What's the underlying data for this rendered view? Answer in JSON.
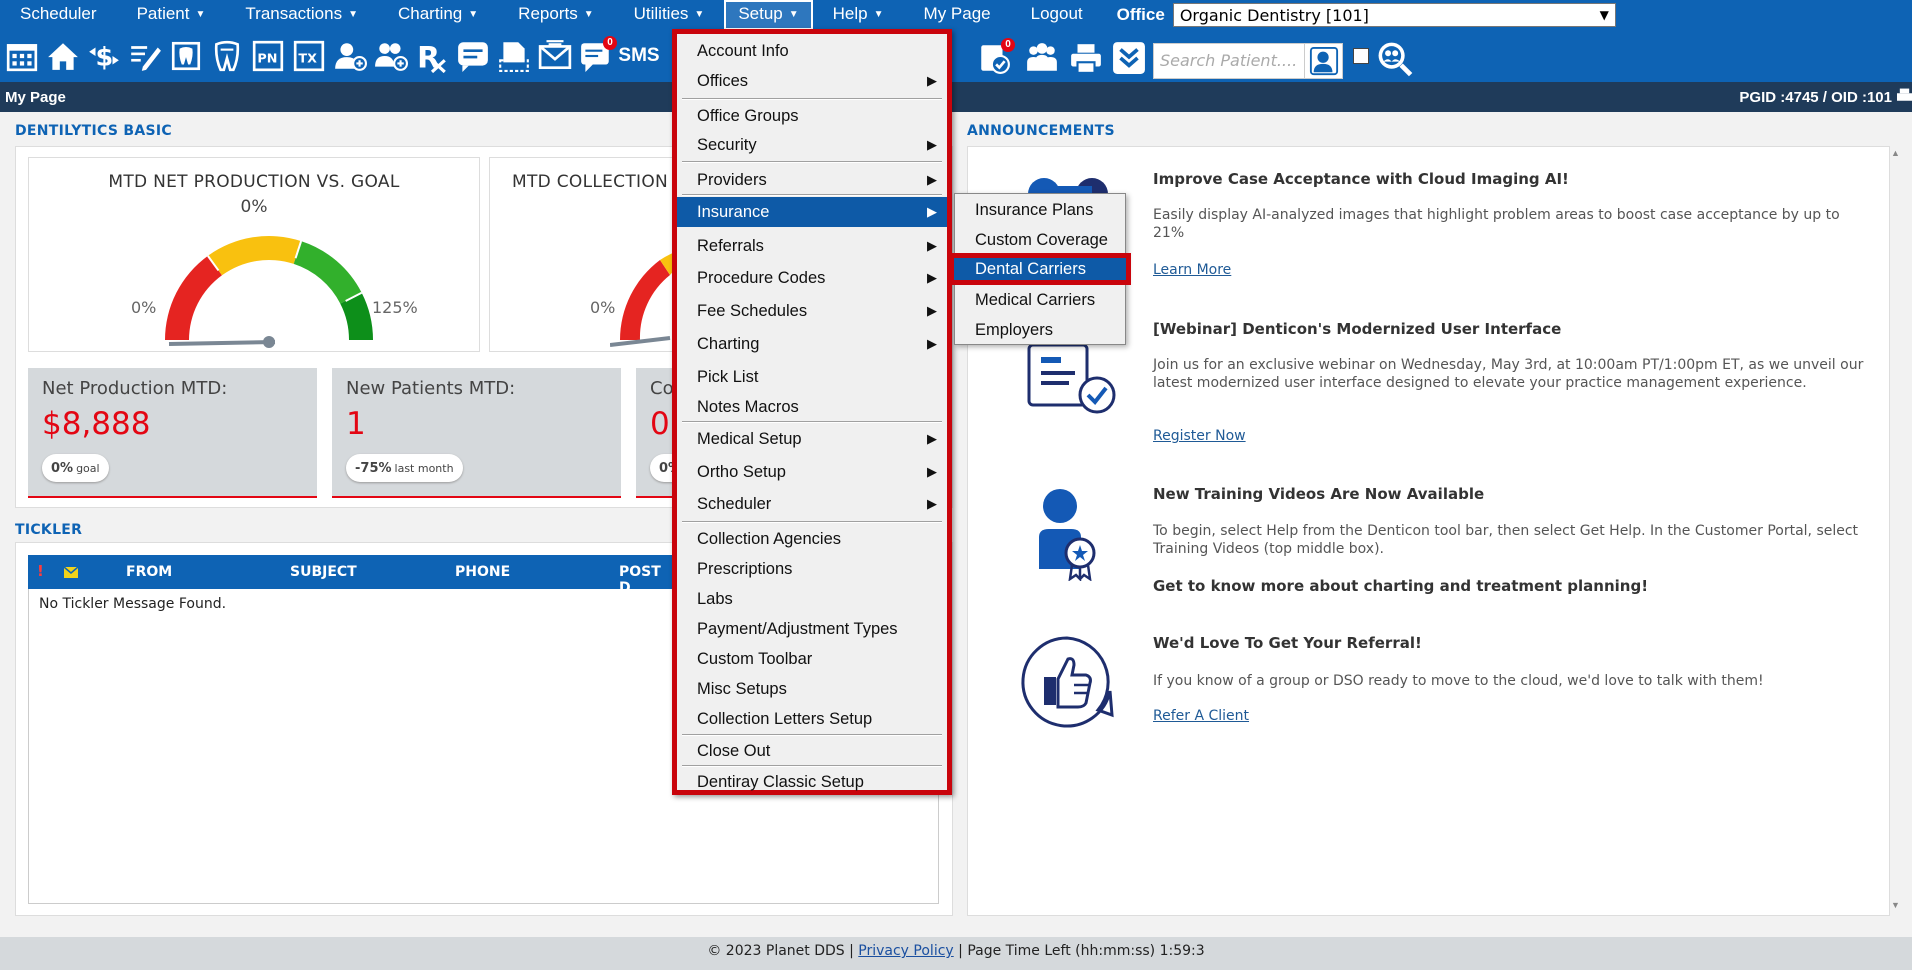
{
  "menubar": {
    "items": [
      {
        "label": "Scheduler",
        "caret": false
      },
      {
        "label": "Patient",
        "caret": true
      },
      {
        "label": "Transactions",
        "caret": true
      },
      {
        "label": "Charting",
        "caret": true
      },
      {
        "label": "Reports",
        "caret": true
      },
      {
        "label": "Utilities",
        "caret": true
      },
      {
        "label": "Setup",
        "caret": true
      },
      {
        "label": "Help",
        "caret": true
      },
      {
        "label": "My Page",
        "caret": false
      },
      {
        "label": "Logout",
        "caret": false
      }
    ],
    "office_label": "Office",
    "office_value": "Organic Dentistry [101]"
  },
  "toolbar": {
    "sms_label": "SMS",
    "badge_messages": "0",
    "badge_clipboard": "0",
    "search_placeholder": "Search Patient...."
  },
  "pagebar": {
    "title": "My Page",
    "ids": "PGID :4745  /  OID :101"
  },
  "dentilytics": {
    "section_title": "DENTILYTICS BASIC",
    "gauge1": {
      "title": "MTD NET PRODUCTION VS. GOAL",
      "pct": "0%",
      "min": "0%",
      "max": "125%",
      "value": 0
    },
    "gauge2": {
      "title": "MTD COLLECTION",
      "min": "0%"
    },
    "kpis": [
      {
        "label": "Net Production MTD:",
        "value": "$8,888",
        "pill_strong": "0%",
        "pill_small": "goal"
      },
      {
        "label": "New Patients MTD:",
        "value": "1",
        "pill_strong": "-75%",
        "pill_small": "last month"
      },
      {
        "label": "Co",
        "value": "0",
        "pill_strong": "0%",
        "pill_small": ""
      }
    ]
  },
  "tickler": {
    "section_title": "TICKLER",
    "columns": [
      "FROM",
      "SUBJECT",
      "PHONE",
      "POST D"
    ],
    "empty_text": "No Tickler Message Found."
  },
  "announcements": {
    "section_title": "ANNOUNCEMENTS",
    "items": [
      {
        "title": "Improve Case Acceptance with Cloud Imaging AI!",
        "body": "Easily display AI-analyzed images that highlight problem areas to boost case acceptance by up to 21%",
        "link": "Learn More"
      },
      {
        "title": "[Webinar] Denticon's Modernized User Interface",
        "body": "Join us for an exclusive webinar on Wednesday, May 3rd, at 10:00am PT/1:00pm ET, as we unveil our latest modernized user interface designed to elevate your practice management experience.",
        "link": "Register Now"
      },
      {
        "title": "New Training Videos Are Now Available",
        "body": "To begin, select Help from the Denticon tool bar, then select Get Help. In the Customer Portal, select Training Videos (top middle box).",
        "strong": "Get to know more about charting and treatment planning!"
      },
      {
        "title": "We'd Love To Get Your Referral!",
        "body": "If you know of a group or DSO ready to move to the cloud, we'd love to talk with them!",
        "link": "Refer A Client"
      }
    ]
  },
  "setup_menu": {
    "items": [
      "Account Info",
      "Offices",
      "Office Groups",
      "Security",
      "Providers",
      "Insurance",
      "Referrals",
      "Procedure Codes",
      "Fee Schedules",
      "Charting",
      "Pick List",
      "Notes Macros",
      "Medical Setup",
      "Ortho Setup",
      "Scheduler",
      "Collection Agencies",
      "Prescriptions",
      "Labs",
      "Payment/Adjustment Types",
      "Custom Toolbar",
      "Misc Setups",
      "Collection Letters Setup",
      "Close Out",
      "Dentiray Classic Setup"
    ]
  },
  "insurance_submenu": {
    "items": [
      "Insurance Plans",
      "Custom Coverage",
      "Dental Carriers",
      "Medical Carriers",
      "Employers"
    ]
  },
  "footer": {
    "copyright": "© 2023 Planet DDS | ",
    "privacy": "Privacy Policy",
    "time_left": " |  Page Time Left (hh:mm:ss) 1:59:3"
  },
  "colors": {
    "brand_blue": "#0e63b4",
    "header_dark": "#1f3b5a",
    "highlight_red": "#c9040c",
    "kpi_red": "#e30613"
  }
}
